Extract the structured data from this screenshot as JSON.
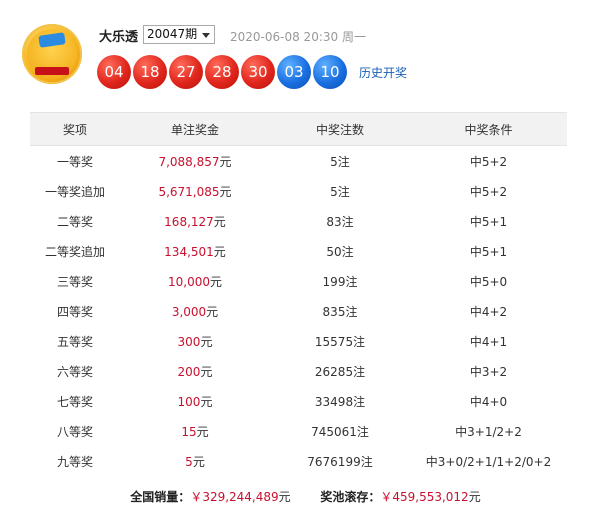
{
  "header": {
    "game_name": "大乐透",
    "period": "20047期",
    "draw_time": "2020-06-08 20:30 周一",
    "history_link": "历史开奖"
  },
  "logo": {
    "icon": "dlt-logo-icon",
    "colors": {
      "red": "#d8141e",
      "gold": "#f6b51e",
      "blue": "#2a8be0"
    }
  },
  "balls": {
    "front": [
      "04",
      "18",
      "27",
      "28",
      "30"
    ],
    "back": [
      "03",
      "10"
    ],
    "colors": {
      "front": "#e0261c",
      "back": "#1a6fe0"
    }
  },
  "table": {
    "headers": [
      "奖项",
      "单注奖金",
      "中奖注数",
      "中奖条件"
    ],
    "rows": [
      {
        "level": "一等奖",
        "amount": "7,088,857",
        "unit": "元",
        "count": "5注",
        "condition": "中5+2"
      },
      {
        "level": "一等奖追加",
        "amount": "5,671,085",
        "unit": "元",
        "count": "5注",
        "condition": "中5+2"
      },
      {
        "level": "二等奖",
        "amount": "168,127",
        "unit": "元",
        "count": "83注",
        "condition": "中5+1"
      },
      {
        "level": "二等奖追加",
        "amount": "134,501",
        "unit": "元",
        "count": "50注",
        "condition": "中5+1"
      },
      {
        "level": "三等奖",
        "amount": "10,000",
        "unit": "元",
        "count": "199注",
        "condition": "中5+0"
      },
      {
        "level": "四等奖",
        "amount": "3,000",
        "unit": "元",
        "count": "835注",
        "condition": "中4+2"
      },
      {
        "level": "五等奖",
        "amount": "300",
        "unit": "元",
        "count": "15575注",
        "condition": "中4+1"
      },
      {
        "level": "六等奖",
        "amount": "200",
        "unit": "元",
        "count": "26285注",
        "condition": "中3+2"
      },
      {
        "level": "七等奖",
        "amount": "100",
        "unit": "元",
        "count": "33498注",
        "condition": "中4+0"
      },
      {
        "level": "八等奖",
        "amount": "15",
        "unit": "元",
        "count": "745061注",
        "condition": "中3+1/2+2"
      },
      {
        "level": "九等奖",
        "amount": "5",
        "unit": "元",
        "count": "7676199注",
        "condition": "中3+0/2+1/1+2/0+2"
      }
    ]
  },
  "summary": {
    "sales_label": "全国销量：",
    "sales_value": "￥329,244,489",
    "sales_unit": "元",
    "pool_label": "奖池滚存：",
    "pool_value": "￥459,553,012",
    "pool_unit": "元"
  },
  "colors": {
    "amount": "#c8102e",
    "link": "#1a5fb4",
    "header_bg": "#f2f2f2"
  }
}
